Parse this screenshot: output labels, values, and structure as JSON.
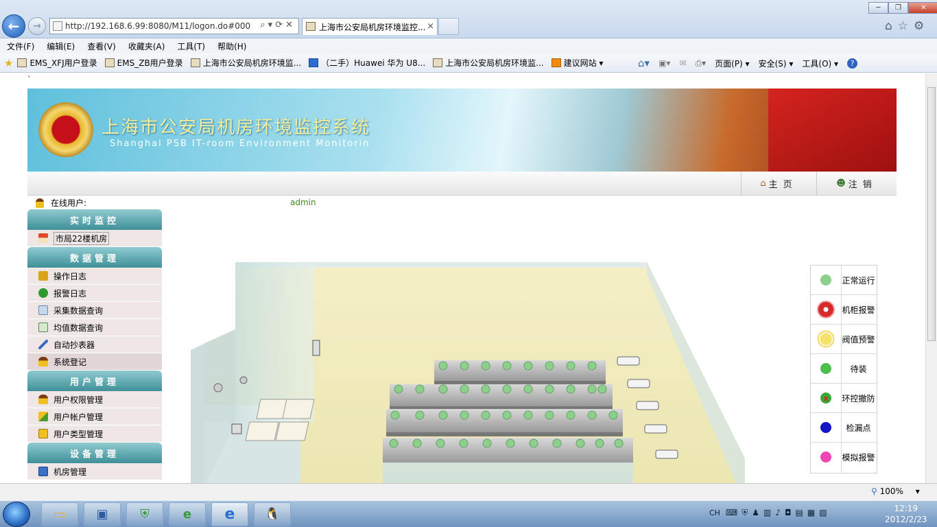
{
  "browser": {
    "url": "http://192.168.6.99:8080/M11/logon.do#000",
    "tab_title": "上海市公安局机房环境监控...",
    "tab_close": "×",
    "menus": [
      "文件(F)",
      "编辑(E)",
      "查看(V)",
      "收藏夹(A)",
      "工具(T)",
      "帮助(H)"
    ],
    "favorites": [
      "EMS_XFJ用户登录",
      "EMS_ZB用户登录",
      "上海市公安局机房环境监...",
      "（二手）Huawei 华为 U8...",
      "上海市公安局机房环境监...",
      "建议网站 ▾"
    ],
    "commands": [
      "页面(P) ▾",
      "安全(S) ▾",
      "工具(O) ▾"
    ],
    "zoom": "100%",
    "window_buttons": [
      "─",
      "❐",
      "✕"
    ]
  },
  "page": {
    "backtick": "`",
    "title_cn": "上海市公安局机房环境监控系统",
    "title_en": "Shanghai PSB IT-room Environment Monitorin",
    "nav": {
      "home": "主页",
      "logout": "注销"
    },
    "online_label": "在线用户:",
    "online_user": "admin"
  },
  "sidebar": {
    "sections": [
      {
        "title": "实时监控",
        "items": [
          "市局22楼机房"
        ]
      },
      {
        "title": "数据管理",
        "items": [
          "操作日志",
          "报警日志",
          "采集数据查询",
          "均值数据查询",
          "自动抄表器",
          "系统登记"
        ]
      },
      {
        "title": "用户管理",
        "items": [
          "用户权限管理",
          "用户帐户管理",
          "用户类型管理"
        ]
      },
      {
        "title": "设备管理",
        "items": [
          "机房管理"
        ]
      }
    ]
  },
  "legend": [
    {
      "label": "正常运行",
      "color": "#8cd08c"
    },
    {
      "label": "机柜报警",
      "color": "#d42a2a"
    },
    {
      "label": "阀值预警",
      "color": "#f3e36a"
    },
    {
      "label": "待装",
      "color": "#4cbf4c"
    },
    {
      "label": "环控撤防",
      "color": "#3aa63a"
    },
    {
      "label": "检漏点",
      "color": "#1515c8"
    },
    {
      "label": "模拟报警",
      "color": "#ee45b5"
    }
  ],
  "taskbar": {
    "lang": "CH",
    "time": "12:19",
    "date": "2012/2/23"
  }
}
